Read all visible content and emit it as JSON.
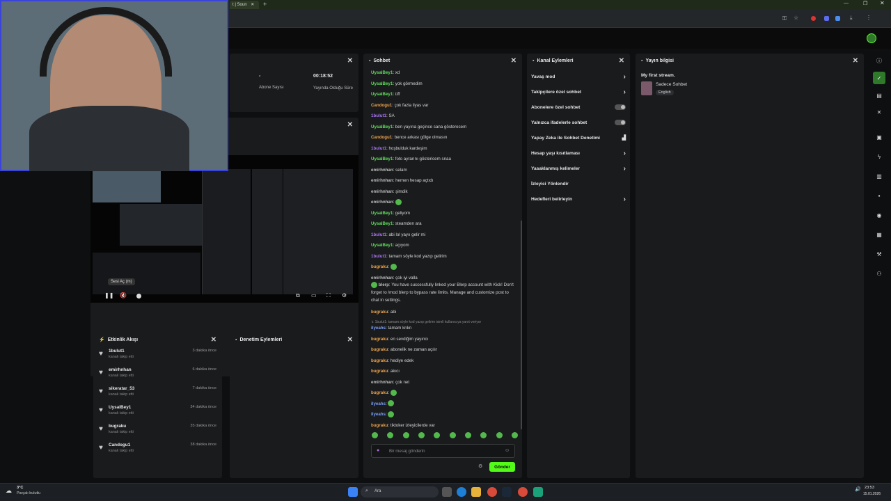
{
  "browser": {
    "tab_title": "t | Soun",
    "new_tab": "+"
  },
  "stream_stats": {
    "subscribers_value": "-",
    "subscribers_label": "Abone Sayısı",
    "live_time_value": "00:18:52",
    "live_time_label": "Yayında Olduğu Süre"
  },
  "player": {
    "tooltip": "Sesi Aç (m)"
  },
  "chat": {
    "title": "Sohbet",
    "input_placeholder": "Bir mesaj gönderin",
    "send_label": "Gönder",
    "messages": [
      {
        "user": "UysalBey1",
        "color": "green",
        "text": "xd"
      },
      {
        "user": "UysalBey1",
        "color": "green",
        "text": "yok görmedim"
      },
      {
        "user": "UysalBey1",
        "color": "green",
        "text": "üff"
      },
      {
        "user": "Candogu1",
        "color": "orange",
        "text": "çok fazla ilyas var"
      },
      {
        "user": "1bulut1",
        "color": "purple",
        "text": "SA"
      },
      {
        "user": "UysalBey1",
        "color": "green",
        "text": "ben yayına geçince sana gösterecem"
      },
      {
        "user": "Candogu1",
        "color": "orange",
        "text": "bence arkası gölge olmasın"
      },
      {
        "user": "1bulut1",
        "color": "purple",
        "text": "hoşbulduk kardeşim"
      },
      {
        "user": "UysalBey1",
        "color": "green",
        "text": "foto ayrarını göstericem snaa"
      },
      {
        "user": "emirhnhan",
        "color": "gray",
        "text": "selam"
      },
      {
        "user": "emirhnhan",
        "color": "gray",
        "text": "hemen hesap açtıdı"
      },
      {
        "user": "emirhnhan",
        "color": "gray",
        "text": "şimdik"
      },
      {
        "user": "emirhnhan",
        "color": "gray",
        "text": "",
        "emote": true
      },
      {
        "user": "UysalBey1",
        "color": "green",
        "text": "geliyom"
      },
      {
        "user": "UysalBey1",
        "color": "green",
        "text": "steamden ara"
      },
      {
        "user": "1bulut1",
        "color": "purple",
        "text": "abi lol yayıı gelir mi"
      },
      {
        "user": "UysalBey1",
        "color": "green",
        "text": "açıyom"
      },
      {
        "user": "1bulut1",
        "color": "purple",
        "text": "tamam söyle kod yazıp gelirim"
      },
      {
        "user": "bugraku",
        "color": "orange",
        "text": "",
        "emote": true
      },
      {
        "user": "emirhnhan",
        "color": "gray",
        "text": "çok iyi valla"
      }
    ],
    "bot_message": {
      "user": "blerp",
      "text": "You have successfully linked your Blerp account with Kick! Don't forget to /mod blerp to bypass rate limits. Manage and customize post to chat in settings."
    },
    "messages2": [
      {
        "user": "bugraku",
        "color": "orange",
        "text": "abi"
      }
    ],
    "reply_context": "↳ 1bulut1: tamam söyle kod yazıp gelirim isimli kullanıcıya yanıt veriyor",
    "messages3": [
      {
        "user": "ilyeahs",
        "color": "blue",
        "text": "tamam knkn"
      },
      {
        "user": "bugraku",
        "color": "orange",
        "text": "en sevdiğim yayıncı"
      },
      {
        "user": "bugraku",
        "color": "orange",
        "text": "abonelik ne zaman açılır"
      },
      {
        "user": "bugraku",
        "color": "orange",
        "text": "hediye edek"
      },
      {
        "user": "bugraku",
        "color": "orange",
        "text": "akıcı"
      },
      {
        "user": "emirhnhan",
        "color": "gray",
        "text": "çok net"
      },
      {
        "user": "bugraku",
        "color": "orange",
        "text": "",
        "emote": true
      },
      {
        "user": "ilyeahs",
        "color": "blue",
        "text": "",
        "emote": true
      },
      {
        "user": "ilyeahs",
        "color": "blue",
        "text": "",
        "emote": true
      },
      {
        "user": "bugraku",
        "color": "orange",
        "text": "tiktoker izleyicilerde var"
      }
    ]
  },
  "channel_actions": {
    "title": "Kanal Eylemleri",
    "items": [
      {
        "label": "Yavaş mod",
        "kind": "chevron"
      },
      {
        "label": "Takipçilere özel sohbet",
        "kind": "chevron"
      },
      {
        "label": "Abonelere özel sohbet",
        "kind": "toggle"
      },
      {
        "label": "Yalnızca ifadelerle sohbet",
        "kind": "toggle"
      },
      {
        "label": "Yapay Zeka ile Sohbet Denetimi",
        "kind": "chart"
      },
      {
        "label": "Hesap yaşı kısıtlaması",
        "kind": "chevron"
      },
      {
        "label": "Yasaklanmış kelimeler",
        "kind": "chevron"
      },
      {
        "label": "İzleyici Yönlendir",
        "kind": "none"
      },
      {
        "label": "Hedefleri belirleyin",
        "kind": "chevron"
      }
    ]
  },
  "stream_info": {
    "title": "Yayın bilgisi",
    "stream_title": "My first stream.",
    "category": "Sadece Sohbet",
    "language": "English"
  },
  "activity": {
    "title": "Etkinlik Akışı",
    "events": [
      {
        "name": "1bulut1",
        "sub": "kanalı takip etti",
        "time": "3 dakika önce"
      },
      {
        "name": "emirhnhan",
        "sub": "kanalı takip etti",
        "time": "6 dakika önce"
      },
      {
        "name": "sikeratar_53",
        "sub": "kanalı takip etti",
        "time": "7 dakika önce"
      },
      {
        "name": "UysalBey1",
        "sub": "kanalı takip etti",
        "time": "34 dakika önce"
      },
      {
        "name": "bugraku",
        "sub": "kanalı takip etti",
        "time": "35 dakika önce"
      },
      {
        "name": "Candogu1",
        "sub": "kanalı takip etti",
        "time": "38 dakika önce"
      }
    ]
  },
  "audit": {
    "title": "Denetim Eylemleri"
  },
  "taskbar": {
    "weather_temp": "3°C",
    "weather_desc": "Parçalı bulutlu",
    "search_placeholder": "Ara",
    "time": "23:53",
    "date": "15.01.2026"
  },
  "colors": {
    "accent": "#53fc18",
    "panel": "#1a1b1d",
    "background": "#0e0f10"
  }
}
